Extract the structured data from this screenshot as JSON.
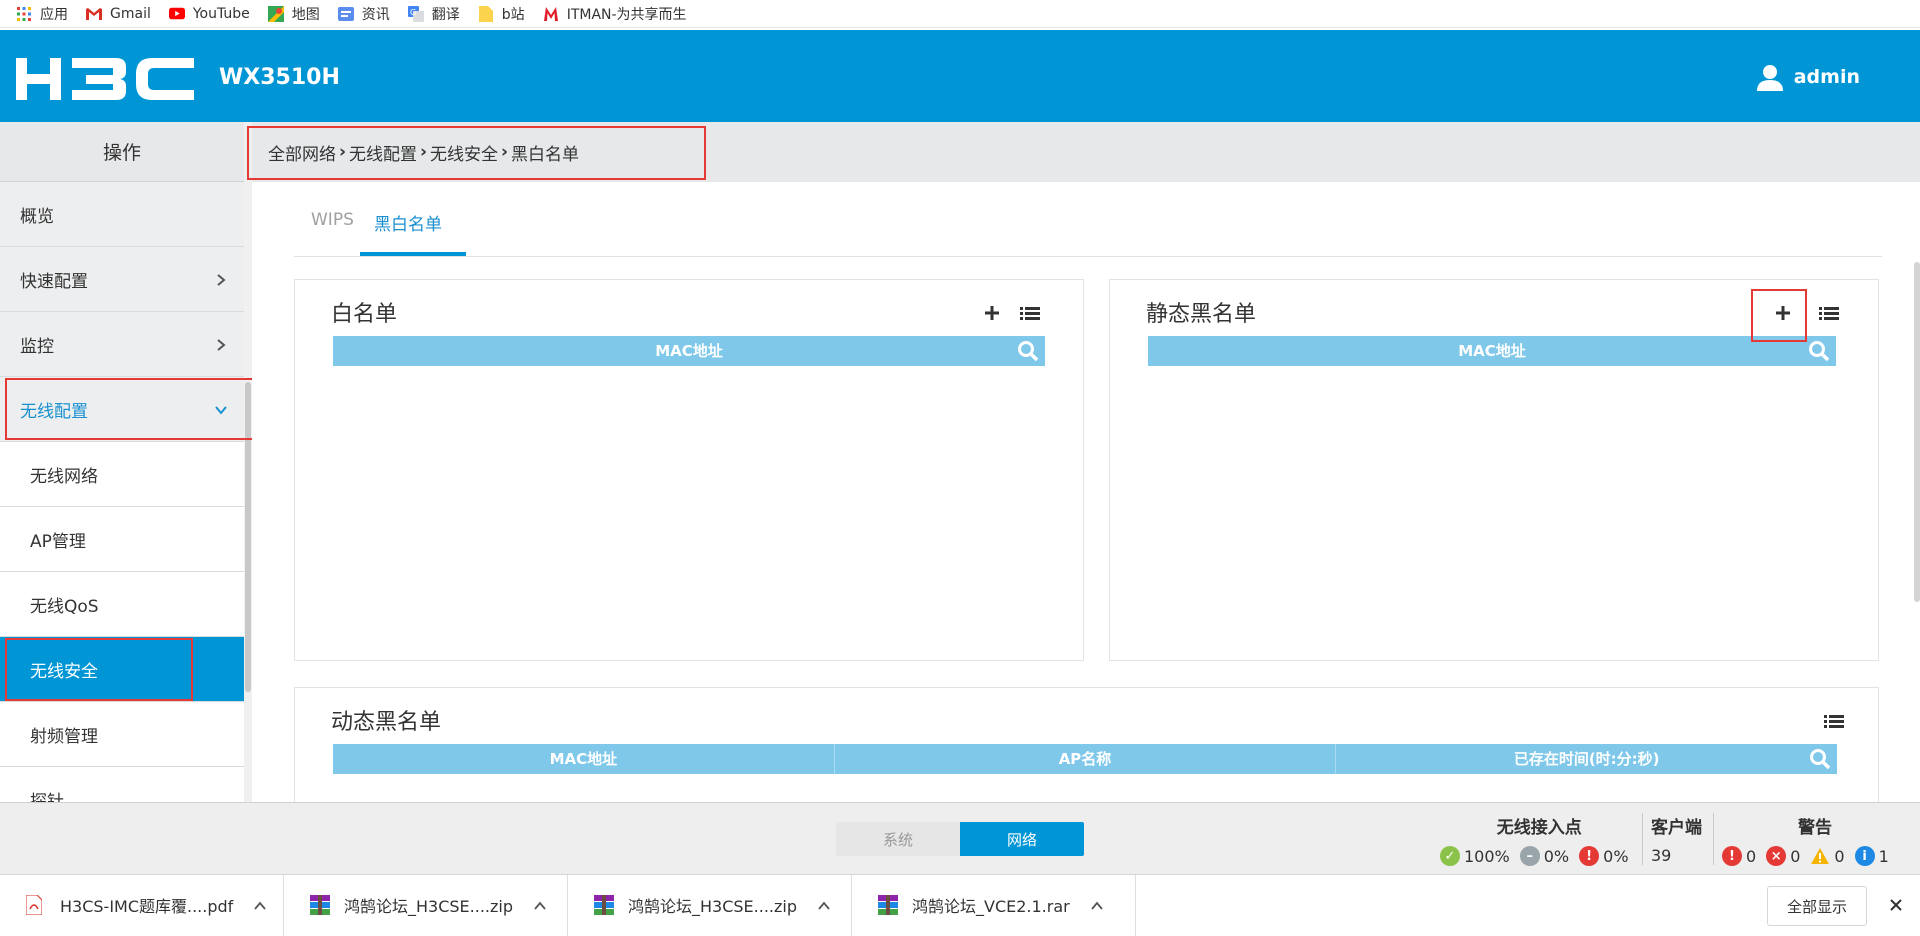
{
  "bookmarks": [
    {
      "label": "应用",
      "icon": "apps-grid-icon"
    },
    {
      "label": "Gmail",
      "icon": "gmail-icon"
    },
    {
      "label": "YouTube",
      "icon": "youtube-icon"
    },
    {
      "label": "地图",
      "icon": "maps-icon"
    },
    {
      "label": "资讯",
      "icon": "news-icon"
    },
    {
      "label": "翻译",
      "icon": "translate-icon"
    },
    {
      "label": "b站",
      "icon": "folder-icon"
    },
    {
      "label": "ITMAN-为共享而生",
      "icon": "itman-icon"
    }
  ],
  "header": {
    "brand": "H3C",
    "model": "WX3510H",
    "user": "admin",
    "color": "#0096d6"
  },
  "sidebar": {
    "title": "操作",
    "items": [
      {
        "label": "概览"
      },
      {
        "label": "快速配置"
      },
      {
        "label": "监控"
      },
      {
        "label": "无线配置"
      },
      {
        "label": "无线网络"
      },
      {
        "label": "AP管理"
      },
      {
        "label": "无线QoS"
      },
      {
        "label": "无线安全"
      },
      {
        "label": "射频管理"
      },
      {
        "label": "探针"
      }
    ]
  },
  "breadcrumb": [
    "全部网络",
    "无线配置",
    "无线安全",
    "黑白名单"
  ],
  "tabs": {
    "inactive": "WIPS",
    "active": "黑白名单"
  },
  "panels": {
    "whitelist": {
      "title": "白名单",
      "columns": [
        "MAC地址"
      ]
    },
    "static_blacklist": {
      "title": "静态黑名单",
      "columns": [
        "MAC地址"
      ]
    },
    "dynamic_blacklist": {
      "title": "动态黑名单",
      "columns": [
        "MAC地址",
        "AP名称",
        "已存在时间(时:分:秒)"
      ]
    }
  },
  "statusbar": {
    "toggle": {
      "system": "系统",
      "network": "网络"
    },
    "ap": {
      "title": "无线接入点",
      "ok": "100%",
      "offline": "0%",
      "fault": "0%"
    },
    "clients": {
      "title": "客户端",
      "count": "39"
    },
    "alarms": {
      "title": "警告",
      "critical": "0",
      "major": "0",
      "warning": "0",
      "info": "1"
    }
  },
  "downloads": [
    {
      "name": "H3CS-IMC题库覆....pdf",
      "type": "pdf"
    },
    {
      "name": "鸿鹄论坛_H3CSE....zip",
      "type": "archive"
    },
    {
      "name": "鸿鹄论坛_H3CSE....zip",
      "type": "archive"
    },
    {
      "name": "鸿鹄论坛_VCE2.1.rar",
      "type": "archive"
    }
  ],
  "download_bar": {
    "show_all": "全部显示"
  }
}
